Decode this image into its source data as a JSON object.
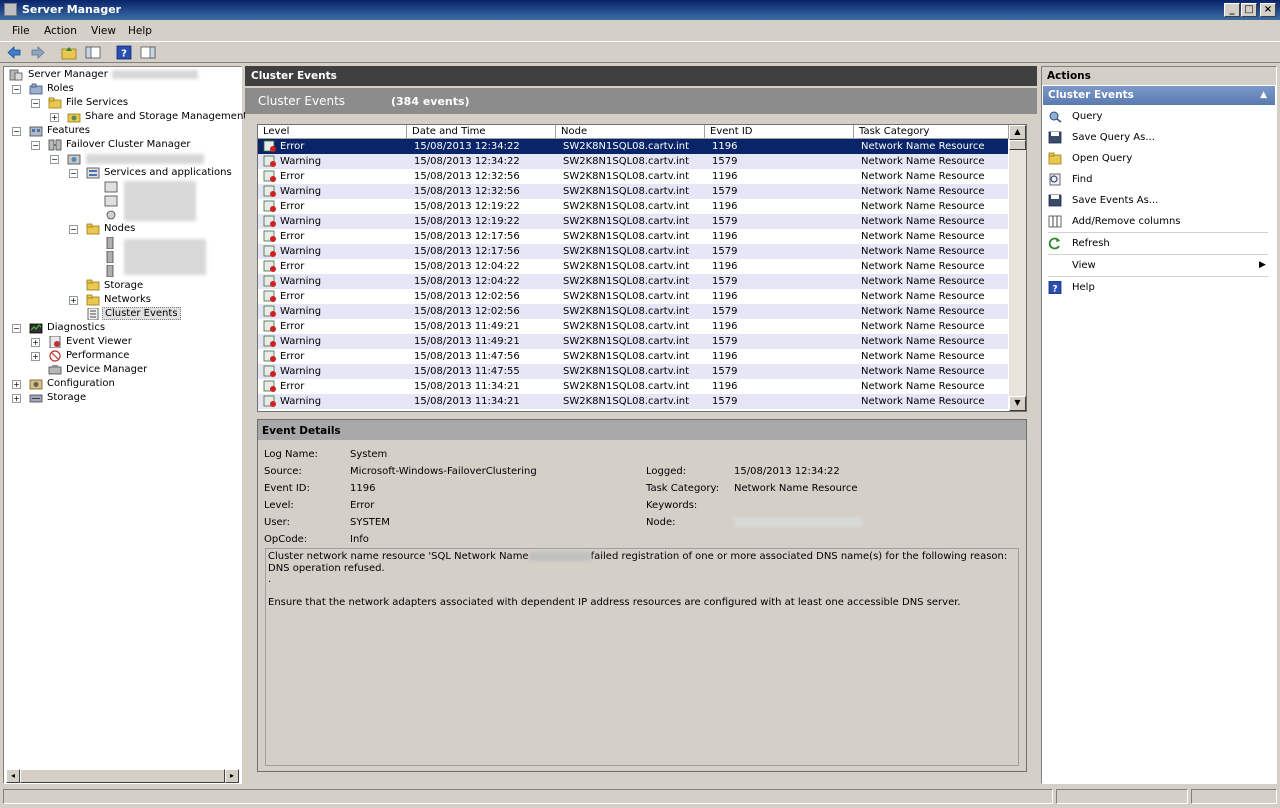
{
  "window": {
    "title": "Server Manager"
  },
  "menu": [
    "File",
    "Action",
    "View",
    "Help"
  ],
  "tree": {
    "root": "Server Manager",
    "roles": "Roles",
    "file_services": "File Services",
    "share_storage": "Share and Storage Management",
    "features": "Features",
    "failover": "Failover Cluster Manager",
    "services_apps": "Services and applications",
    "nodes": "Nodes",
    "storage_cluster": "Storage",
    "networks": "Networks",
    "cluster_events": "Cluster Events",
    "diagnostics": "Diagnostics",
    "event_viewer": "Event Viewer",
    "performance": "Performance",
    "device_manager": "Device Manager",
    "configuration": "Configuration",
    "storage": "Storage"
  },
  "center": {
    "header": "Cluster Events",
    "title": "Cluster Events",
    "count": "(384 events)",
    "columns": [
      "Level",
      "Date and Time",
      "Node",
      "Event ID",
      "Task Category"
    ],
    "rows": [
      {
        "level": "Error",
        "date": "15/08/2013 12:34:22",
        "node": "SW2K8N1SQL08.cartv.int",
        "id": "1196",
        "cat": "Network Name Resource"
      },
      {
        "level": "Warning",
        "date": "15/08/2013 12:34:22",
        "node": "SW2K8N1SQL08.cartv.int",
        "id": "1579",
        "cat": "Network Name Resource"
      },
      {
        "level": "Error",
        "date": "15/08/2013 12:32:56",
        "node": "SW2K8N1SQL08.cartv.int",
        "id": "1196",
        "cat": "Network Name Resource"
      },
      {
        "level": "Warning",
        "date": "15/08/2013 12:32:56",
        "node": "SW2K8N1SQL08.cartv.int",
        "id": "1579",
        "cat": "Network Name Resource"
      },
      {
        "level": "Error",
        "date": "15/08/2013 12:19:22",
        "node": "SW2K8N1SQL08.cartv.int",
        "id": "1196",
        "cat": "Network Name Resource"
      },
      {
        "level": "Warning",
        "date": "15/08/2013 12:19:22",
        "node": "SW2K8N1SQL08.cartv.int",
        "id": "1579",
        "cat": "Network Name Resource"
      },
      {
        "level": "Error",
        "date": "15/08/2013 12:17:56",
        "node": "SW2K8N1SQL08.cartv.int",
        "id": "1196",
        "cat": "Network Name Resource"
      },
      {
        "level": "Warning",
        "date": "15/08/2013 12:17:56",
        "node": "SW2K8N1SQL08.cartv.int",
        "id": "1579",
        "cat": "Network Name Resource"
      },
      {
        "level": "Error",
        "date": "15/08/2013 12:04:22",
        "node": "SW2K8N1SQL08.cartv.int",
        "id": "1196",
        "cat": "Network Name Resource"
      },
      {
        "level": "Warning",
        "date": "15/08/2013 12:04:22",
        "node": "SW2K8N1SQL08.cartv.int",
        "id": "1579",
        "cat": "Network Name Resource"
      },
      {
        "level": "Error",
        "date": "15/08/2013 12:02:56",
        "node": "SW2K8N1SQL08.cartv.int",
        "id": "1196",
        "cat": "Network Name Resource"
      },
      {
        "level": "Warning",
        "date": "15/08/2013 12:02:56",
        "node": "SW2K8N1SQL08.cartv.int",
        "id": "1579",
        "cat": "Network Name Resource"
      },
      {
        "level": "Error",
        "date": "15/08/2013 11:49:21",
        "node": "SW2K8N1SQL08.cartv.int",
        "id": "1196",
        "cat": "Network Name Resource"
      },
      {
        "level": "Warning",
        "date": "15/08/2013 11:49:21",
        "node": "SW2K8N1SQL08.cartv.int",
        "id": "1579",
        "cat": "Network Name Resource"
      },
      {
        "level": "Error",
        "date": "15/08/2013 11:47:56",
        "node": "SW2K8N1SQL08.cartv.int",
        "id": "1196",
        "cat": "Network Name Resource"
      },
      {
        "level": "Warning",
        "date": "15/08/2013 11:47:55",
        "node": "SW2K8N1SQL08.cartv.int",
        "id": "1579",
        "cat": "Network Name Resource"
      },
      {
        "level": "Error",
        "date": "15/08/2013 11:34:21",
        "node": "SW2K8N1SQL08.cartv.int",
        "id": "1196",
        "cat": "Network Name Resource"
      },
      {
        "level": "Warning",
        "date": "15/08/2013 11:34:21",
        "node": "SW2K8N1SQL08.cartv.int",
        "id": "1579",
        "cat": "Network Name Resource"
      }
    ]
  },
  "details": {
    "header": "Event Details",
    "log_name_label": "Log Name:",
    "log_name": "System",
    "source_label": "Source:",
    "source": "Microsoft-Windows-FailoverClustering",
    "logged_label": "Logged:",
    "logged": "15/08/2013 12:34:22",
    "event_id_label": "Event ID:",
    "event_id": "1196",
    "task_label": "Task Category:",
    "task": "Network Name Resource",
    "level_label": "Level:",
    "level": "Error",
    "keywords_label": "Keywords:",
    "user_label": "User:",
    "user": "SYSTEM",
    "node_label": "Node:",
    "opcode_label": "OpCode:",
    "opcode": "Info",
    "desc_line1a": "Cluster network name resource 'SQL Network Name",
    "desc_line1b": "failed registration of one or more associated DNS name(s) for the following reason:",
    "desc_line2": "DNS operation refused.",
    "desc_line3": ".",
    "desc_line4": "Ensure that the network adapters associated with dependent IP address resources are configured with at least one accessible DNS server."
  },
  "actions": {
    "header": "Actions",
    "group": "Cluster Events",
    "items": [
      "Query",
      "Save Query As...",
      "Open Query",
      "Find",
      "Save Events As...",
      "Add/Remove columns",
      "Refresh",
      "View",
      "Help"
    ]
  }
}
